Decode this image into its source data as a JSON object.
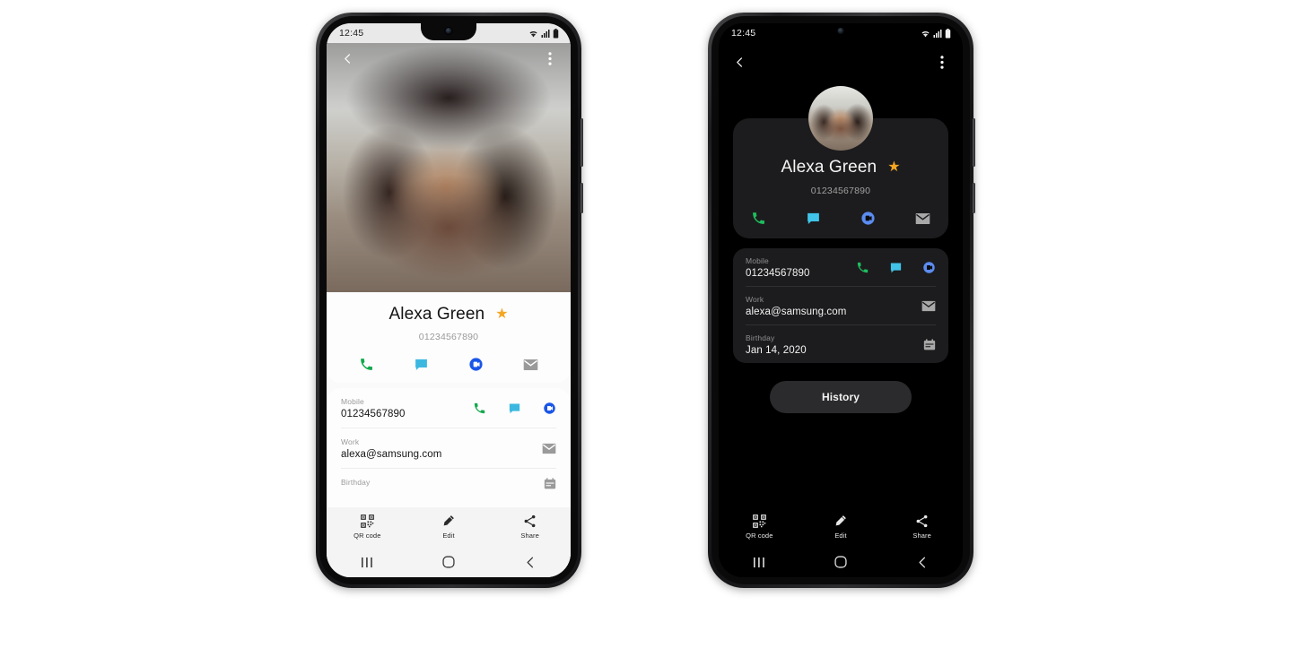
{
  "scene": {
    "description": "Two Samsung phone mockups showing a contact detail screen in light theme and dark theme"
  },
  "phone_light": {
    "theme": "light",
    "status_bar": {
      "time": "12:45",
      "wifi_icon": "wifi-icon",
      "signal_icon": "signal-bars-icon",
      "battery_icon": "battery-full-icon"
    },
    "app_bar": {
      "back_icon": "back-chevron-icon",
      "menu_icon": "more-options-icon"
    },
    "photo": {
      "alt_name": "contact-cover-photo"
    },
    "contact": {
      "name": "Alexa Green",
      "favorite_icon": "star-filled-icon",
      "number": "01234567890"
    },
    "quick_actions": [
      {
        "name": "call-action",
        "icon": "phone-icon",
        "color": "#14a84d"
      },
      {
        "name": "message-action",
        "icon": "message-bubble-icon",
        "color": "#3cb8e0"
      },
      {
        "name": "video-call-action",
        "icon": "duo-video-icon",
        "color": "#1a56e8"
      },
      {
        "name": "email-action",
        "icon": "envelope-icon",
        "color": "#9a9a9a"
      }
    ],
    "fields": [
      {
        "label": "Mobile",
        "value": "01234567890",
        "icons": [
          {
            "name": "call-icon",
            "icon": "phone-icon",
            "color": "#14a84d"
          },
          {
            "name": "message-icon",
            "icon": "message-bubble-icon",
            "color": "#3cb8e0"
          },
          {
            "name": "video-icon",
            "icon": "duo-video-icon",
            "color": "#1a56e8"
          }
        ]
      },
      {
        "label": "Work",
        "value": "alexa@samsung.com",
        "icons": [
          {
            "name": "email-icon",
            "icon": "envelope-icon",
            "color": "#9a9a9a"
          }
        ]
      },
      {
        "label": "Birthday",
        "value": "",
        "icons": [
          {
            "name": "calendar-icon",
            "icon": "calendar-icon",
            "color": "#9a9a9a"
          }
        ]
      }
    ],
    "toolbar": [
      {
        "label": "QR code",
        "icon": "qr-code-icon"
      },
      {
        "label": "Edit",
        "icon": "pencil-icon"
      },
      {
        "label": "Share",
        "icon": "share-icon"
      }
    ],
    "nav_bar": [
      {
        "name": "recents-button",
        "icon": "recents-icon"
      },
      {
        "name": "home-button",
        "icon": "home-icon"
      },
      {
        "name": "back-button",
        "icon": "back-icon"
      }
    ]
  },
  "phone_dark": {
    "theme": "dark",
    "status_bar": {
      "time": "12:45",
      "wifi_icon": "wifi-icon",
      "signal_icon": "signal-bars-icon",
      "battery_icon": "battery-full-icon"
    },
    "app_bar": {
      "back_icon": "back-chevron-icon",
      "menu_icon": "more-options-icon"
    },
    "avatar": {
      "alt_name": "contact-avatar-photo"
    },
    "contact": {
      "name": "Alexa Green",
      "favorite_icon": "star-filled-icon",
      "number": "01234567890"
    },
    "quick_actions": [
      {
        "name": "call-action",
        "icon": "phone-icon",
        "color": "#1fbd5e"
      },
      {
        "name": "message-action",
        "icon": "message-bubble-icon",
        "color": "#41c4e8"
      },
      {
        "name": "video-call-action",
        "icon": "duo-video-icon",
        "color": "#5b8cf0"
      },
      {
        "name": "email-action",
        "icon": "envelope-icon",
        "color": "#a8a8a8"
      }
    ],
    "fields": [
      {
        "label": "Mobile",
        "value": "01234567890",
        "icons": [
          {
            "name": "call-icon",
            "icon": "phone-icon",
            "color": "#1fbd5e"
          },
          {
            "name": "message-icon",
            "icon": "message-bubble-icon",
            "color": "#41c4e8"
          },
          {
            "name": "video-icon",
            "icon": "duo-video-icon",
            "color": "#5b8cf0"
          }
        ]
      },
      {
        "label": "Work",
        "value": "alexa@samsung.com",
        "icons": [
          {
            "name": "email-icon",
            "icon": "envelope-icon",
            "color": "#a8a8a8"
          }
        ]
      },
      {
        "label": "Birthday",
        "value": "Jan 14, 2020",
        "icons": [
          {
            "name": "calendar-icon",
            "icon": "calendar-icon",
            "color": "#a8a8a8"
          }
        ]
      }
    ],
    "history_button": {
      "label": "History"
    },
    "toolbar": [
      {
        "label": "QR code",
        "icon": "qr-code-icon"
      },
      {
        "label": "Edit",
        "icon": "pencil-icon"
      },
      {
        "label": "Share",
        "icon": "share-icon"
      }
    ],
    "nav_bar": [
      {
        "name": "recents-button",
        "icon": "recents-icon"
      },
      {
        "name": "home-button",
        "icon": "home-icon"
      },
      {
        "name": "back-button",
        "icon": "back-icon"
      }
    ]
  }
}
